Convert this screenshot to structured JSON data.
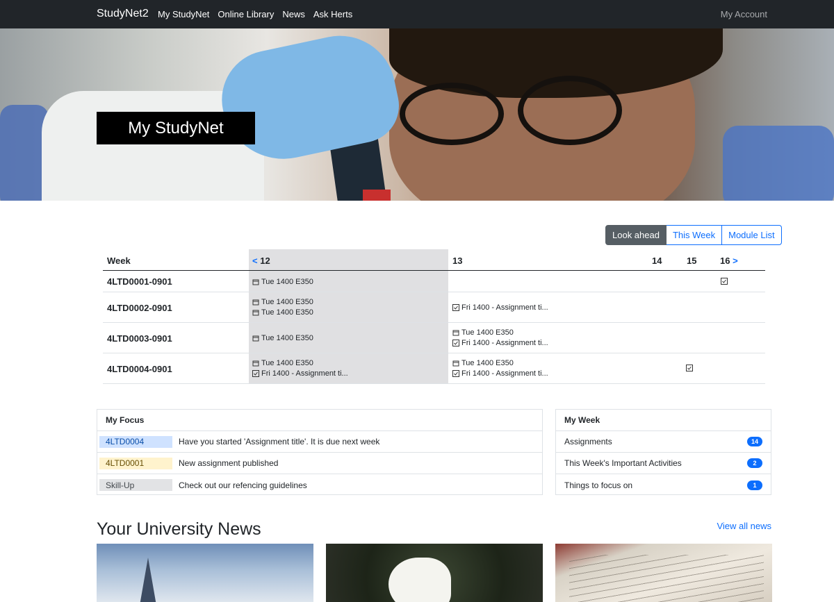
{
  "navbar": {
    "brand": "StudyNet2",
    "links": [
      "My StudyNet",
      "Online Library",
      "News",
      "Ask Herts"
    ],
    "account": "My Account"
  },
  "hero": {
    "title": "My StudyNet"
  },
  "view_toggle": {
    "options": [
      "Look ahead",
      "This Week",
      "Module List"
    ],
    "active": "Look ahead"
  },
  "timetable": {
    "header": {
      "label": "Week",
      "prev_arrow": "<",
      "next_arrow": ">",
      "weeks": [
        "12",
        "13",
        "14",
        "15",
        "16"
      ]
    },
    "rows": [
      {
        "module": "4LTD0001-0901",
        "w12": [
          "Tue 1400 E350"
        ],
        "w13": []
      },
      {
        "module": "4LTD0002-0901",
        "w12": [
          "Tue 1400 E350",
          "Tue 1400 E350"
        ],
        "w13": [
          "Fri 1400 - Assignment ti..."
        ]
      },
      {
        "module": "4LTD0003-0901",
        "w12": [
          "Tue 1400 E350"
        ],
        "w13": [
          "Tue 1400 E350",
          "Fri 1400 - Assignment ti..."
        ]
      },
      {
        "module": "4LTD0004-0901",
        "w12": [
          "Tue 1400 E350",
          "Fri 1400 - Assignment ti..."
        ],
        "w13": [
          "Tue 1400 E350",
          "Fri 1400 - Assignment ti..."
        ]
      }
    ]
  },
  "my_focus": {
    "title": "My Focus",
    "items": [
      {
        "tag": "4LTD0004",
        "tag_color": "#cfe2ff",
        "text": "Have you started 'Assignment title'. It is due next week"
      },
      {
        "tag": "4LTD0001",
        "tag_color": "#fff3cd",
        "text": "New assignment published"
      },
      {
        "tag": "Skill-Up",
        "tag_color": "#e2e3e5",
        "text": "Check out our refencing guidelines"
      }
    ]
  },
  "my_week": {
    "title": "My Week",
    "items": [
      {
        "label": "Assignments",
        "count": "14"
      },
      {
        "label": "This Week's Important Activities",
        "count": "2"
      },
      {
        "label": "Things to focus on",
        "count": "1"
      }
    ]
  },
  "news": {
    "title": "Your University News",
    "view_all": "View all news"
  },
  "colors": {
    "accent": "#0d6efd",
    "nav_bg": "#212529",
    "active_toggle": "#565e64",
    "shade": "#e0e0e2"
  }
}
